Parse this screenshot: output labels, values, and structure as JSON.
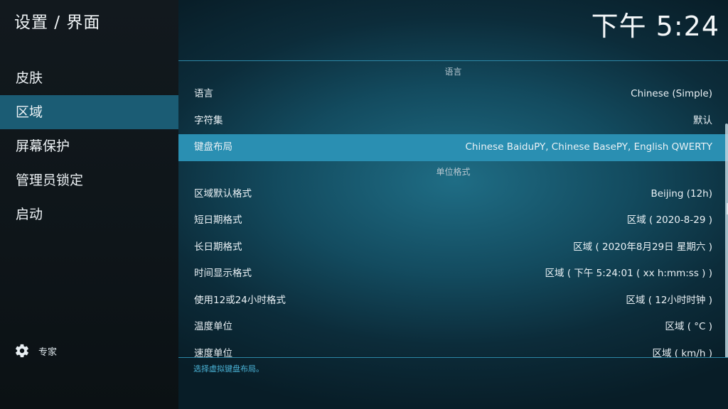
{
  "header": {
    "title": "设置 / 界面",
    "clock": "下午 5:24"
  },
  "sidebar": {
    "items": [
      {
        "label": "皮肤"
      },
      {
        "label": "区域"
      },
      {
        "label": "屏幕保护"
      },
      {
        "label": "管理员锁定"
      },
      {
        "label": "启动"
      }
    ],
    "active_index": 1,
    "expert_label": "专家"
  },
  "sections": [
    {
      "header": "语言",
      "rows": [
        {
          "label": "语言",
          "value": "Chinese (Simple)"
        },
        {
          "label": "字符集",
          "value": "默认"
        },
        {
          "label": "键盘布局",
          "value": "Chinese BaiduPY, Chinese BasePY, English QWERTY"
        }
      ]
    },
    {
      "header": "单位格式",
      "rows": [
        {
          "label": "区域默认格式",
          "value": "Beijing (12h)"
        },
        {
          "label": "短日期格式",
          "value": "区域 ( 2020-8-29 )"
        },
        {
          "label": "长日期格式",
          "value": "区域 ( 2020年8月29日 星期六 )"
        },
        {
          "label": "时间显示格式",
          "value": "区域 ( 下午 5:24:01 ( xx h:mm:ss ) )"
        },
        {
          "label": "使用12或24小时格式",
          "value": "区域 ( 12小时时钟 )"
        },
        {
          "label": "温度单位",
          "value": "区域 ( °C )"
        },
        {
          "label": "速度单位",
          "value": "区域 ( km/h )"
        }
      ]
    }
  ],
  "footer": {
    "hint": "选择虚拟键盘布局。"
  },
  "colors": {
    "accent": "#2a8fb2",
    "sidebar_active": "#1b5c74",
    "hint": "#4ab3d6"
  }
}
